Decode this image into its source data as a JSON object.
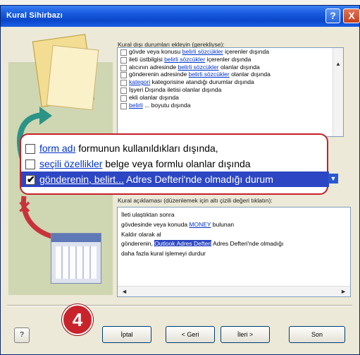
{
  "window": {
    "title": "Kural Sihirbazı",
    "help_glyph": "?",
    "close_glyph": "X"
  },
  "exceptions": {
    "label": "Kural dışı durumları ekleyin (gerekliyse):",
    "items": [
      {
        "pre": "",
        "link": "",
        "post": "gövde veya konusu ",
        "link2": "belirli sözcükler",
        "post2": " içerenler dışında"
      },
      {
        "pre": "",
        "link": "",
        "post": "ileti üstbilgisi ",
        "link2": "belirli sözcükler",
        "post2": " içerenler dışında"
      },
      {
        "pre": "",
        "link": "",
        "post": "alıcının adresinde ",
        "link2": "belirli sözcükler",
        "post2": " olanlar dışında"
      },
      {
        "pre": "",
        "link": "",
        "post": "gönderenin adresinde ",
        "link2": "belirli sözcükler",
        "post2": " olanlar dışında"
      },
      {
        "pre": "",
        "link": "kategori",
        "post": " kategorisine atandığı durumlar dışında",
        "link2": "",
        "post2": ""
      },
      {
        "pre": "",
        "link": "",
        "post": "İşyeri Dışında iletisi olanlar dışında",
        "link2": "",
        "post2": ""
      },
      {
        "pre": "",
        "link": "",
        "post": "ekli olanlar dışında",
        "link2": "",
        "post2": ""
      },
      {
        "pre": "",
        "link": "belirli",
        "post": " ... boyutu dışında",
        "link2": "",
        "post2": ""
      }
    ],
    "scroll_up": "▲",
    "scroll_down": "▼"
  },
  "zoomed": {
    "rows": [
      {
        "link": "form adı",
        "text": " formunun kullanıldıkları dışında,",
        "checked": false
      },
      {
        "link": "seçili özellikler",
        "text": " belge veya formlu olanlar dışında",
        "checked": false
      },
      {
        "link": "gönderenin, belirt...",
        "text": " Adres Defteri'nde olmadığı durum",
        "checked": true
      }
    ],
    "check_glyph": "✔",
    "scroll_glyph": "▼"
  },
  "description": {
    "label": "Kural açıklaması (düzenlemek için altı çizili değeri tıklatın):",
    "lines": [
      {
        "pre": "İleti ulaştıktan sonra",
        "link": "",
        "post": ""
      },
      {
        "pre": "gövdesinde veya konuda ",
        "link": "MONEY",
        "post": " bulunan"
      },
      {
        "pre": "Kaldır olarak al",
        "link": "",
        "post": ""
      },
      {
        "pre": "gönderenin, ",
        "link": "Outlook Adres Defteri",
        "post": " Adres Defteri'nde olmadığı"
      },
      {
        "pre": "daha fazla kural işlemeyi durdur",
        "link": "",
        "post": ""
      }
    ],
    "scroll_left": "◄",
    "scroll_right": "►"
  },
  "buttons": {
    "help_small": "?",
    "cancel": "İptal",
    "back": "< Geri",
    "next": "İleri >",
    "finish": "Son"
  },
  "badge_number": "4"
}
